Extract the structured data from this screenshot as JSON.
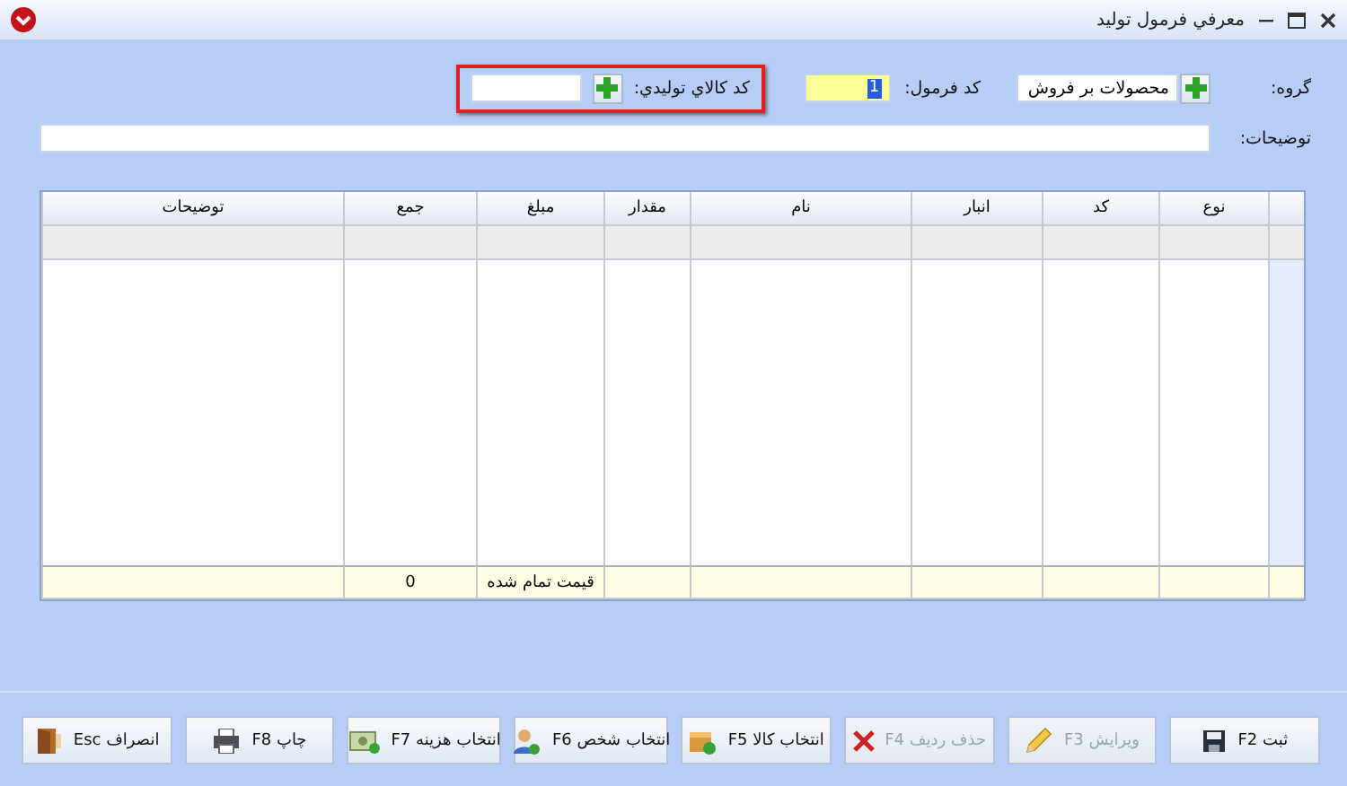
{
  "window": {
    "title": "معرفي فرمول توليد"
  },
  "form": {
    "group": {
      "label": "گروه:",
      "value": "محصولات بر فروش"
    },
    "formula_code": {
      "label": "کد فرمول:",
      "value": "1",
      "focused": true
    },
    "product_code": {
      "label": "کد کالاي توليدي:",
      "highlighted": true
    },
    "description": {
      "label": "توضيحات:"
    }
  },
  "table": {
    "columns": [
      {
        "label": "نوع"
      },
      {
        "label": "کد"
      },
      {
        "label": "انبار"
      },
      {
        "label": "نام"
      },
      {
        "label": "مقدار"
      },
      {
        "label": "مبلغ"
      },
      {
        "label": "جمع"
      },
      {
        "label": "توضيحات"
      }
    ],
    "footer": {
      "label": "قیمت تمام شده",
      "total": "0"
    }
  },
  "buttons": [
    {
      "label": "ثبت F2",
      "kind": "save",
      "disabled": false
    },
    {
      "label": "ویرایش F3",
      "kind": "edit",
      "disabled": true
    },
    {
      "label": "حذف ردیف F4",
      "kind": "delete",
      "disabled": true
    },
    {
      "label": "انتخاب کالا F5",
      "kind": "product",
      "disabled": false
    },
    {
      "label": "انتخاب شخص F6",
      "kind": "person",
      "disabled": false
    },
    {
      "label": "انتخاب هزینه F7",
      "kind": "cost",
      "disabled": false
    },
    {
      "label": "چاپ F8",
      "kind": "print",
      "disabled": false
    },
    {
      "label": "انصراف Esc",
      "kind": "exit",
      "disabled": false
    }
  ]
}
